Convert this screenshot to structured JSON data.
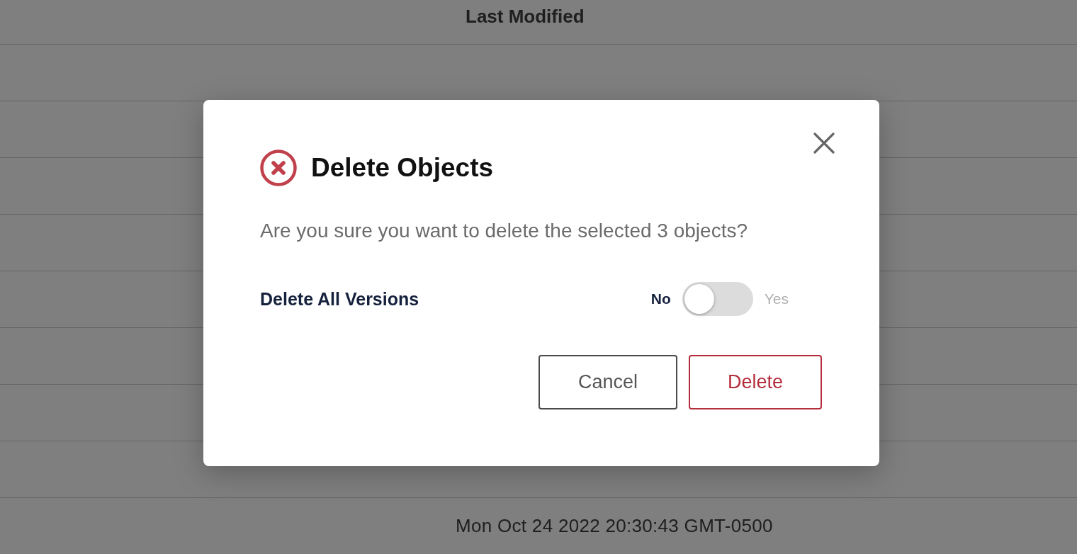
{
  "table": {
    "columns": [
      {
        "label": "Last Modified"
      }
    ],
    "rows": [
      {
        "last_modified": "Mon Oct 24 2022 20:30:43 GMT-0500"
      }
    ]
  },
  "dialog": {
    "title": "Delete Objects",
    "message": "Are you sure you want to delete the selected 3 objects?",
    "option": {
      "label": "Delete All Versions",
      "off_label": "No",
      "on_label": "Yes",
      "on": false
    },
    "buttons": [
      {
        "label": "Cancel",
        "kind": "secondary"
      },
      {
        "label": "Delete",
        "kind": "danger"
      }
    ]
  }
}
